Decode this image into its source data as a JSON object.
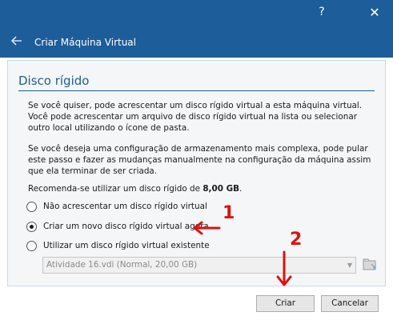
{
  "window": {
    "help_icon": "?",
    "close_icon": "✕",
    "title": "Criar Máquina Virtual"
  },
  "section": {
    "title": "Disco rígido"
  },
  "paragraphs": {
    "p1": "Se você quiser, pode acrescentar um disco rígido virtual a esta máquina virtual. Você pode acrescentar um arquivo de disco rígido virtual na lista ou selecionar outro local utilizando o ícone de pasta.",
    "p2": "Se você deseja uma configuração de armazenamento mais complexa, pode pular este passo e fazer as mudanças manualmente na configuração da máquina assim que ela terminar de ser criada.",
    "p3_prefix": "Recomenda-se utilizar um disco rígido de ",
    "p3_size": "8,00 GB",
    "p3_suffix": "."
  },
  "options": [
    {
      "label": "Não acrescentar um disco rígido virtual",
      "checked": false
    },
    {
      "label": "Criar um novo disco rígido virtual agora",
      "checked": true
    },
    {
      "label": "Utilizar um disco rígido virtual existente",
      "checked": false
    }
  ],
  "disk_select": {
    "value": "Atividade 16.vdi (Normal, 20,00 GB)"
  },
  "buttons": {
    "create": "Criar",
    "cancel": "Cancelar"
  },
  "annotations": {
    "step1": "1",
    "step2": "2",
    "color": "#e01010"
  },
  "colors": {
    "titlebar": "#1d5d99",
    "accent": "#1d5d99"
  }
}
